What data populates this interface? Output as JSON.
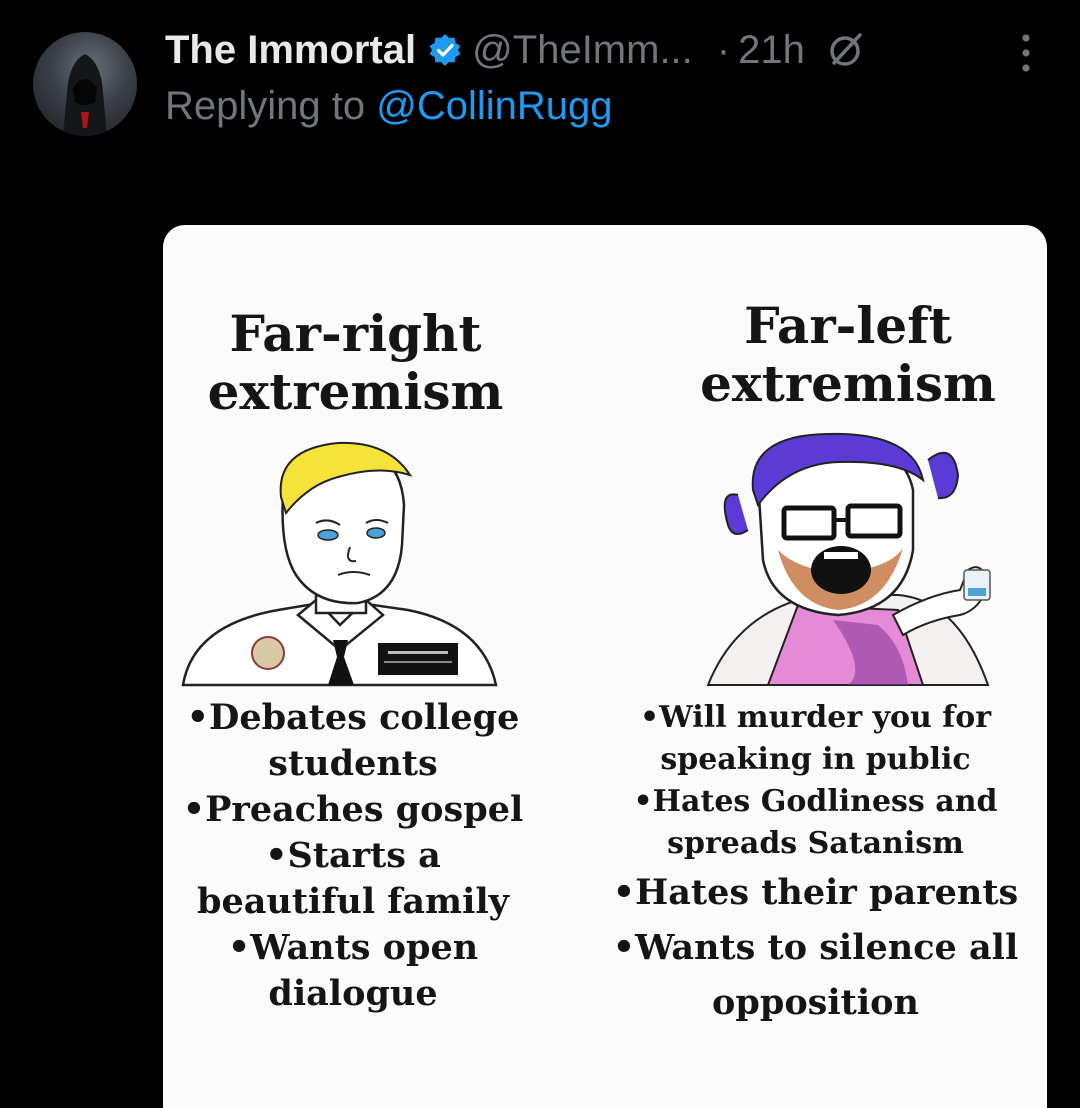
{
  "tweet": {
    "display_name": "The Immortal",
    "handle": "@TheImm...",
    "separator": "·",
    "time": "21h",
    "reply_prefix": "Replying to ",
    "reply_mention": "@CollinRugg",
    "icons": [
      "avatar",
      "verified-badge-icon",
      "grok-icon",
      "more-options-icon"
    ]
  },
  "meme": {
    "left": {
      "title": [
        "Far-right",
        "extremism"
      ],
      "points": [
        "•Debates college",
        "students",
        "•Preaches gospel",
        "•Starts a",
        "beautiful family",
        "•Wants open",
        "dialogue"
      ]
    },
    "right": {
      "title": [
        "Far-left",
        "extremism"
      ],
      "points": [
        "•Will murder you for",
        "speaking in public",
        "•Hates Godliness and",
        "spreads Satanism",
        "•Hates their parents",
        "•Wants to silence all",
        "opposition"
      ]
    }
  },
  "colors": {
    "background": "#000000",
    "primary_text": "#e7e9ea",
    "secondary_text": "#71767b",
    "link": "#1d9bf0",
    "verified": "#1d9bf0"
  }
}
